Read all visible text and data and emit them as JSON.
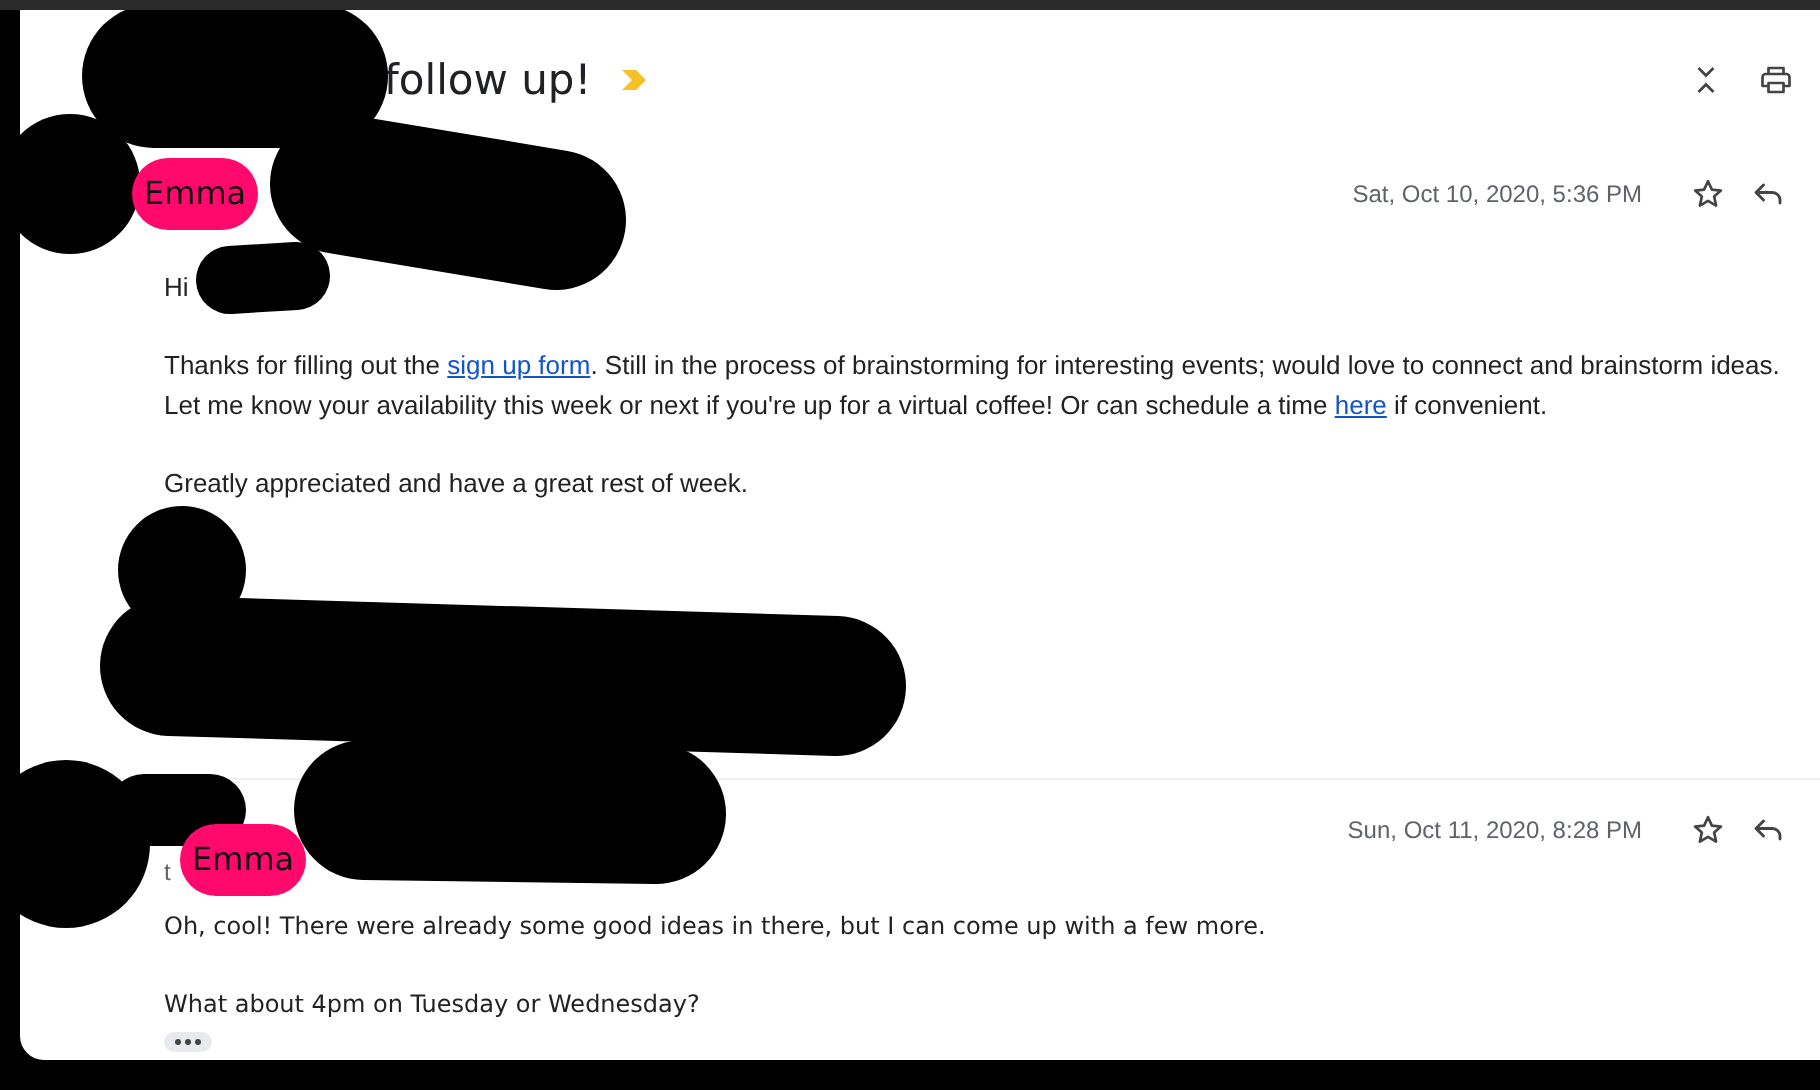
{
  "subject": {
    "text": "follow up!",
    "important": true
  },
  "messages": [
    {
      "recipient": {
        "name": "Emma"
      },
      "date": "Sat, Oct 10, 2020, 5:36 PM",
      "starred": false,
      "greeting": "Hi",
      "paragraphs": [
        [
          {
            "text": "Thanks for filling out the "
          },
          {
            "text": "sign up form",
            "link": true
          },
          {
            "text": ". Still in the process of brainstorming for interesting events; would love to connect and brainstorm ideas. Let me know your availability this week or next if you're up for a virtual coffee! Or can schedule a time "
          },
          {
            "text": "here",
            "link": true
          },
          {
            "text": " if convenient."
          }
        ],
        [
          {
            "text": "Greatly appreciated and have a great rest of week."
          }
        ]
      ]
    },
    {
      "recipient": {
        "prefix": "t",
        "name": "Emma"
      },
      "date": "Sun, Oct 11, 2020, 8:28 PM",
      "starred": false,
      "paragraphs": [
        [
          {
            "text": "Oh, cool! There were already some good ideas in there, but I can come up with a few more."
          }
        ],
        [
          {
            "text": "What about 4pm on Tuesday or Wednesday?"
          }
        ]
      ],
      "trimmed": true
    }
  ]
}
